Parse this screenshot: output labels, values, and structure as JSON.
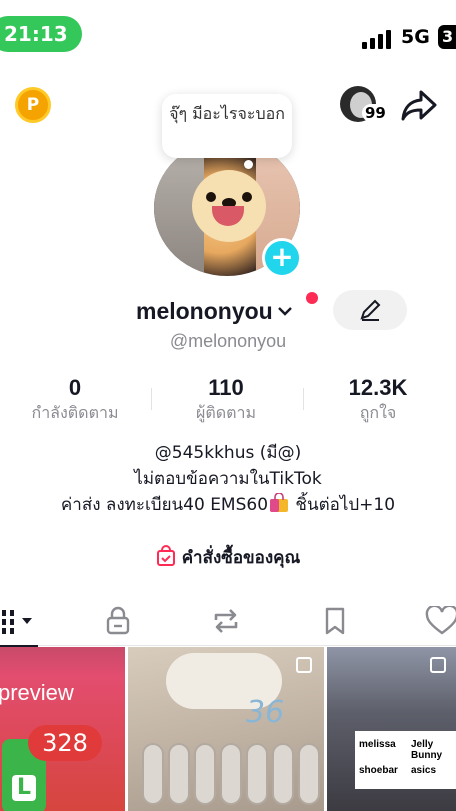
{
  "status": {
    "time": "21:13",
    "network": "5G",
    "battery": "3"
  },
  "header": {
    "coin_letter": "P",
    "visitor_count": "99"
  },
  "profile": {
    "note_bubble": "จุ๊ๆ มีอะไรจะบอก",
    "username": "melononyou",
    "handle": "@melononyou"
  },
  "stats": [
    {
      "value": "0",
      "label": "กำลังติดตาม"
    },
    {
      "value": "110",
      "label": "ผู้ติดตาม"
    },
    {
      "value": "12.3K",
      "label": "ถูกใจ"
    }
  ],
  "bio": {
    "line1": "@545kkhus (มี@)",
    "line2": "ไม่ตอบข้อความในTikTok",
    "line3a": "ค่าส่ง ลงทะเบียน40 EMS60",
    "line3b": " ชิ้นต่อไป+10"
  },
  "orders_label": "คำสั่งซื้อของคุณ",
  "tabs": [
    {
      "name": "videos",
      "icon": "grid-icon"
    },
    {
      "name": "private",
      "icon": "lock-icon"
    },
    {
      "name": "reposts",
      "icon": "repost-icon"
    },
    {
      "name": "favorites",
      "icon": "bookmark-icon"
    },
    {
      "name": "liked",
      "icon": "heart-icon"
    }
  ],
  "grid": {
    "cell1": {
      "text": "preview",
      "badge": "328",
      "app_letter": "L"
    },
    "cell2": {
      "text": "36"
    },
    "cell3": {
      "brands": [
        "melissa",
        "Jelly Bunny",
        "shoebar",
        "asics"
      ]
    }
  },
  "colors": {
    "accent": "#fe2c55",
    "plus": "#20d5ec",
    "status_pill": "#34c759"
  }
}
